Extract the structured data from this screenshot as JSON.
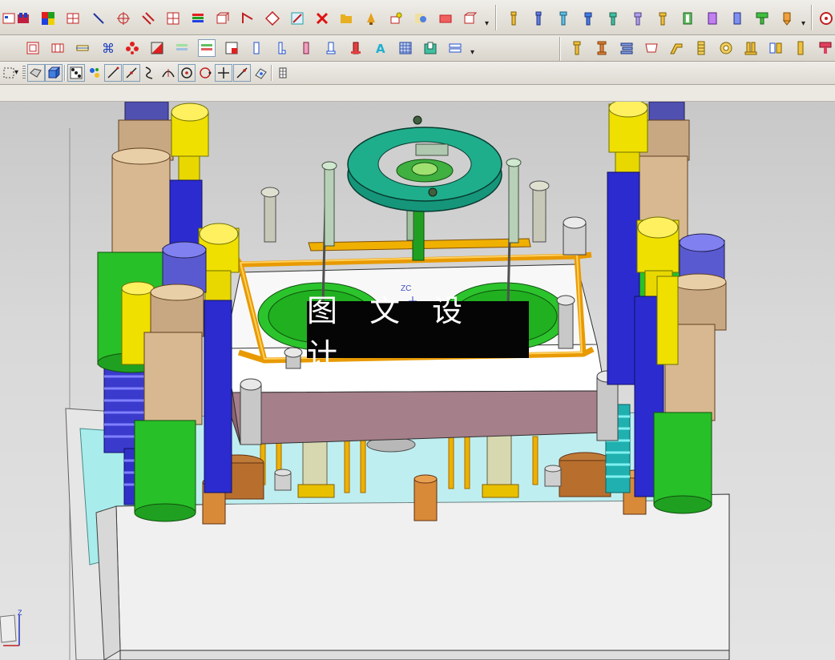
{
  "toolbars": {
    "row1_more": "▾",
    "row2_more": "▾",
    "row3_dropdown": "▾"
  },
  "watermark": {
    "text": "图 文 设 计"
  },
  "viewport": {
    "wcs_label": "ZC",
    "triad_label": "Z"
  },
  "colors": {
    "plate_white": "#f4f4f4",
    "plate_pink": "#c9a1ab",
    "ring_teal": "#1a9e80",
    "bushing_tan": "#c8a882",
    "pillar_green": "#2fc32f",
    "pin_yellow": "#f0e000",
    "pin_blue": "#2b2bd0",
    "cavity_green": "#28c828",
    "cooling_orange": "#f0a000",
    "screw_gray": "#c8c8c8"
  }
}
